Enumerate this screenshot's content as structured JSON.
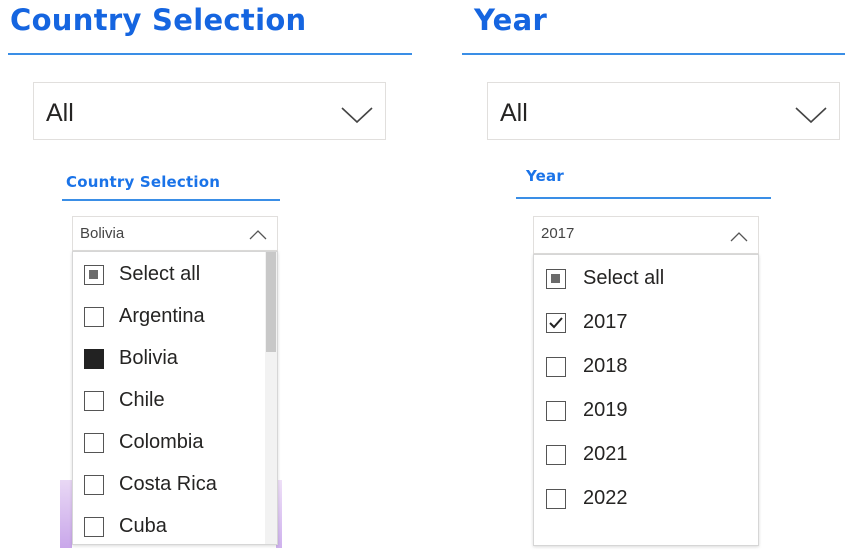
{
  "country": {
    "title": "Country Selection",
    "value": "All",
    "popup_title": "Country Selection",
    "popup_value": "Bolivia",
    "items": [
      {
        "label": "Select all",
        "state": "partial"
      },
      {
        "label": "Argentina",
        "state": "unchecked"
      },
      {
        "label": "Bolivia",
        "state": "filled"
      },
      {
        "label": "Chile",
        "state": "unchecked"
      },
      {
        "label": "Colombia",
        "state": "unchecked"
      },
      {
        "label": "Costa Rica",
        "state": "unchecked"
      },
      {
        "label": "Cuba",
        "state": "unchecked"
      }
    ]
  },
  "year": {
    "title": "Year",
    "value": "All",
    "popup_title": "Year",
    "popup_value": "2017",
    "items": [
      {
        "label": "Select all",
        "state": "partial"
      },
      {
        "label": "2017",
        "state": "checked"
      },
      {
        "label": "2018",
        "state": "unchecked"
      },
      {
        "label": "2019",
        "state": "unchecked"
      },
      {
        "label": "2021",
        "state": "unchecked"
      },
      {
        "label": "2022",
        "state": "unchecked"
      }
    ]
  },
  "colors": {
    "title_blue": "#1565e0",
    "accent_line": "#3a8ee6",
    "filled_box": "#222222"
  },
  "icons": [
    "chevron-down-icon",
    "chevron-up-icon",
    "checkbox-icon",
    "checkmark-icon"
  ]
}
